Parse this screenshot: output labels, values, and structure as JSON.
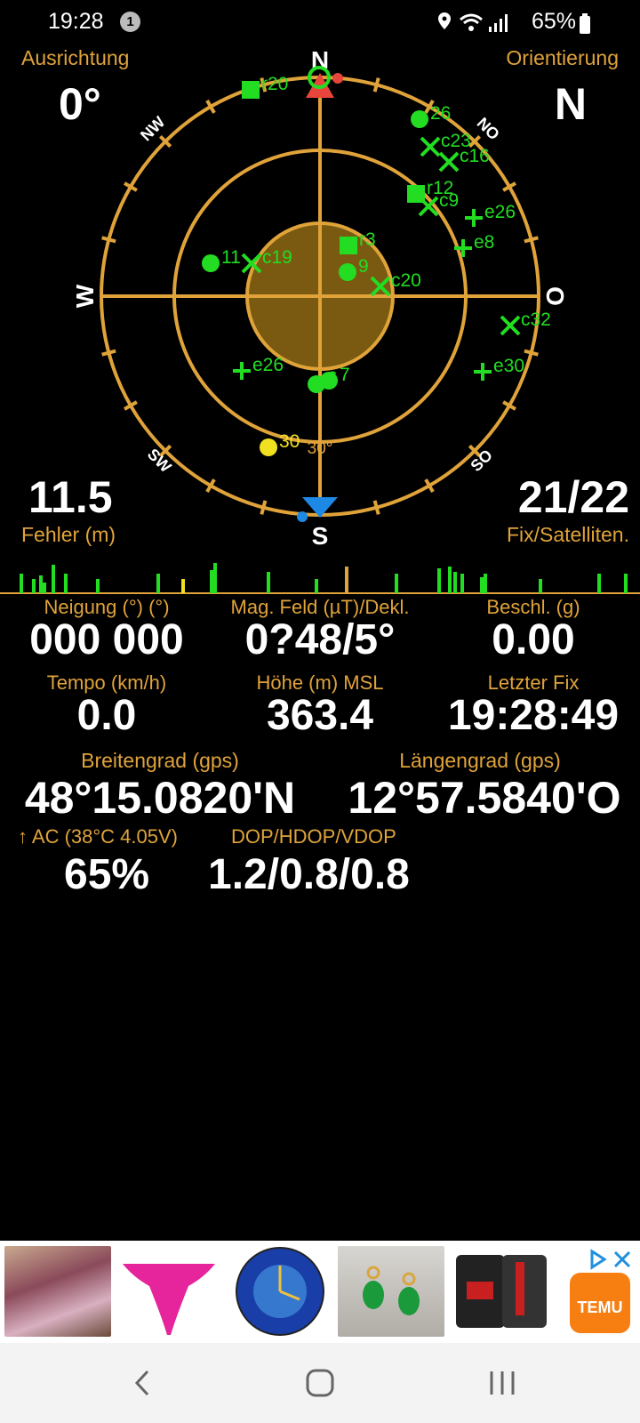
{
  "status": {
    "time": "19:28",
    "badge": "1",
    "battery": "65%"
  },
  "top": {
    "left_label": "Ausrichtung",
    "left_value": "0°",
    "right_label": "Orientierung",
    "right_value": "N"
  },
  "compass": {
    "n": "N",
    "s": "S",
    "w": "W",
    "o": "O",
    "nw": "NW",
    "no": "NO",
    "sw": "SW",
    "so": "SO",
    "elev30": "30°"
  },
  "satellites": [
    {
      "label": "r20",
      "shape": "square",
      "color": "#22dd22"
    },
    {
      "label": "26",
      "shape": "circle",
      "color": "#22dd22"
    },
    {
      "label": "c23",
      "shape": "x",
      "color": "#22dd22"
    },
    {
      "label": "c16",
      "shape": "x",
      "color": "#22dd22"
    },
    {
      "label": "r12",
      "shape": "square",
      "color": "#22dd22"
    },
    {
      "label": "c9",
      "shape": "x",
      "color": "#22dd22"
    },
    {
      "label": "e26",
      "shape": "plus",
      "color": "#22dd22"
    },
    {
      "label": "e8",
      "shape": "plus",
      "color": "#22dd22"
    },
    {
      "label": "r3",
      "shape": "square",
      "color": "#22dd22"
    },
    {
      "label": "9",
      "shape": "circle",
      "color": "#22dd22"
    },
    {
      "label": "11",
      "shape": "circle",
      "color": "#22dd22"
    },
    {
      "label": "c19",
      "shape": "x",
      "color": "#22dd22"
    },
    {
      "label": "c20",
      "shape": "x",
      "color": "#22dd22"
    },
    {
      "label": "c32",
      "shape": "x",
      "color": "#22dd22"
    },
    {
      "label": "e30",
      "shape": "plus",
      "color": "#22dd22"
    },
    {
      "label": "e26",
      "shape": "plus",
      "color": "#22dd22"
    },
    {
      "label": "7",
      "shape": "circle",
      "color": "#22dd22"
    },
    {
      "label": "6",
      "shape": "circle",
      "color": "#22dd22"
    },
    {
      "label": "30",
      "shape": "circle",
      "color": "#f0e020"
    }
  ],
  "mid": {
    "left_value": "11.5",
    "left_label": "Fehler (m)",
    "right_value": "21/22",
    "right_label": "Fix/Satelliten."
  },
  "grid": [
    {
      "label": "Neigung (°) (°)",
      "value": "000 000"
    },
    {
      "label": "Mag. Feld (µT)/Dekl.",
      "value": "0?48/5°"
    },
    {
      "label": "Beschl. (g)",
      "value": "0.00"
    },
    {
      "label": "Tempo (km/h)",
      "value": "0.0"
    },
    {
      "label": "Höhe (m) MSL",
      "value": "363.4"
    },
    {
      "label": "Letzter Fix",
      "value": "19:28:49"
    }
  ],
  "coords": {
    "lat_label": "Breitengrad (gps)",
    "lat_value": "48°15.0820'N",
    "lon_label": "Längengrad (gps)",
    "lon_value": "12°57.5840'O"
  },
  "battery_row": {
    "bat_label": "↑ AC (38°C 4.05V)",
    "bat_value": "65%",
    "dop_label": "DOP/HDOP/VDOP",
    "dop_value": "1.2/0.8/0.8"
  },
  "ad": {
    "brand": "TEMU"
  },
  "colors": {
    "gold": "#e0a33a",
    "green": "#22dd22",
    "yellow": "#f0e020",
    "red": "#e8453c",
    "blue": "#1e88e5"
  }
}
